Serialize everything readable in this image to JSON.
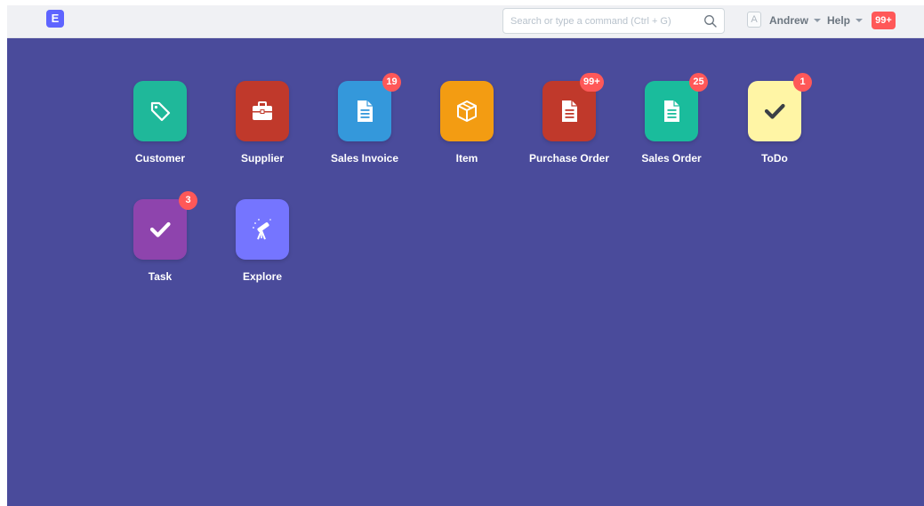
{
  "navbar": {
    "logo_letter": "E",
    "search": {
      "placeholder": "Search or type a command (Ctrl + G)",
      "value": ""
    },
    "avatar_letter": "A",
    "user_label": "Andrew",
    "help_label": "Help",
    "notification_count": "99+"
  },
  "modules": [
    {
      "label": "Customer",
      "color": "#1fb89a",
      "icon": "tag-icon",
      "badge": ""
    },
    {
      "label": "Supplier",
      "color": "#c0392b",
      "icon": "briefcase-icon",
      "badge": ""
    },
    {
      "label": "Sales Invoice",
      "color": "#3498db",
      "icon": "document-icon",
      "badge": "19"
    },
    {
      "label": "Item",
      "color": "#f39c12",
      "icon": "box-icon",
      "badge": ""
    },
    {
      "label": "Purchase Order",
      "color": "#c0392b",
      "icon": "document-icon",
      "badge": "99+"
    },
    {
      "label": "Sales Order",
      "color": "#1abc9c",
      "icon": "document-icon",
      "badge": "25"
    },
    {
      "label": "ToDo",
      "color": "#fff5a5",
      "icon": "check-icon",
      "badge": "1"
    },
    {
      "label": "Task",
      "color": "#8e44ad",
      "icon": "check-icon",
      "badge": "3"
    },
    {
      "label": "Explore",
      "color": "#7575ff",
      "icon": "telescope-icon",
      "badge": ""
    }
  ]
}
